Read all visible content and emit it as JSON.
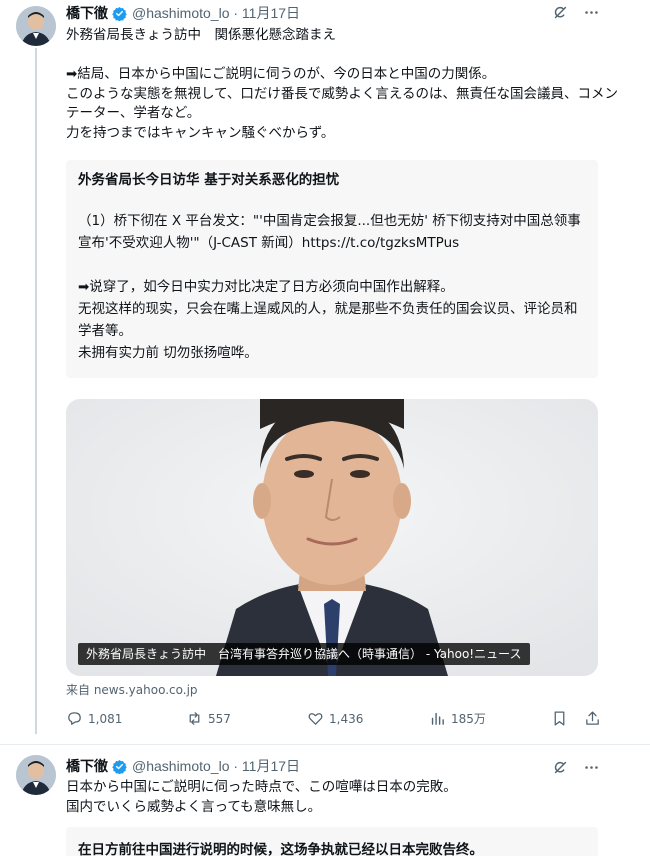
{
  "tweet1": {
    "author_name": "橋下徹",
    "handle_time": "@hashimoto_lo · 11月17日",
    "text": "外務省局長きょう訪中　関係悪化懸念踏まえ\n\n➡結局、日本から中国にご説明に伺うのが、今の日本と中国の力関係。\nこのような実態を無視して、口だけ番長で威勢よく言えるのは、無責任な国会議員、コメンテーター、学者など。\n力を持つまではキャンキャン騒ぐべからず。",
    "quote": {
      "title": "外务省局长今日访华 基于对关系恶化的担忧",
      "text": "（1）桥下彻在 X 平台发文：\"'中国肯定会报复...但也无妨' 桥下彻支持对中国总领事宣布'不受欢迎人物'\"（J-CAST 新闻）https://t.co/tgzksMTPus\n\n➡说穿了，如今日中实力对比决定了日方必须向中国作出解释。\n无视这样的现实，只会在嘴上逞威风的人，就是那些不负责任的国会议员、评论员和学者等。\n未拥有实力前 切勿张扬喧哗。"
    },
    "media_caption": "外務省局長きょう訪中　台湾有事答弁巡り協議へ（時事通信） - Yahoo!ニュース",
    "source": "来自 news.yahoo.co.jp",
    "actions": {
      "replies": "1,081",
      "reposts": "557",
      "likes": "1,436",
      "views": "185万"
    }
  },
  "tweet2": {
    "author_name": "橋下徹",
    "handle_time": "@hashimoto_lo · 11月17日",
    "text": "日本から中国にご説明に伺った時点で、この喧嘩は日本の完敗。\n国内でいくら威勢よく言っても意味無し。",
    "quote_text": "在日方前往中国进行说明的时候，这场争执就已经以日本完败告终。"
  },
  "colors": {
    "verified": "#1d9bf0",
    "secondary_text": "#536471",
    "quote_bg": "#f7f7f7"
  },
  "icons": {
    "verified": "verified-badge-icon",
    "grok": "grok-icon",
    "more": "more-icon",
    "reply": "reply-icon",
    "repost": "repost-icon",
    "like": "like-icon",
    "views": "views-icon",
    "bookmark": "bookmark-icon",
    "share": "share-icon"
  }
}
